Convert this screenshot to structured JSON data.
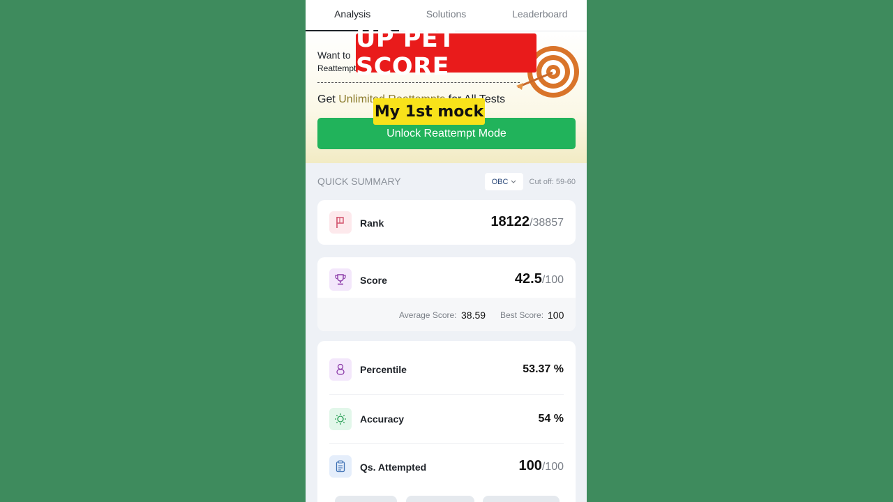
{
  "tabs": [
    "Analysis",
    "Solutions",
    "Leaderboard"
  ],
  "promo": {
    "want_to": "Want to",
    "reattempt_small": "Reattempt",
    "get_prefix": "Get",
    "get_highlight": "Unlimited Reattempts",
    "get_suffix": "for All Tests",
    "unlock_button": "Unlock Reattempt Mode"
  },
  "overlay": {
    "headline": "UP PET SCORE",
    "caption": "My 1st mock"
  },
  "summary": {
    "title": "QUICK SUMMARY",
    "category": "OBC",
    "cutoff_label": "Cut off:",
    "cutoff_value": "59-60"
  },
  "rank": {
    "label": "Rank",
    "value": "18122",
    "total": "/38857"
  },
  "score": {
    "label": "Score",
    "value": "42.5",
    "total": "/100",
    "avg_label": "Average Score:",
    "avg_value": "38.59",
    "best_label": "Best Score:",
    "best_value": "100"
  },
  "percentile": {
    "label": "Percentile",
    "value": "53.37 %"
  },
  "accuracy": {
    "label": "Accuracy",
    "value": "54 %"
  },
  "attempted": {
    "label": "Qs. Attempted",
    "value": "100",
    "total": "/100"
  },
  "colors": {
    "unlock_button": "#21b35b",
    "headline_bg": "#e91b1b",
    "caption_bg": "#f8e21a",
    "page_bg": "#3e8b5d"
  }
}
